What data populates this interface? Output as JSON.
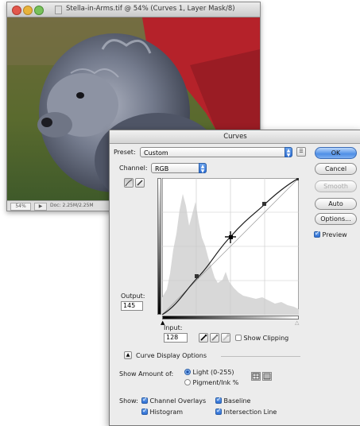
{
  "document": {
    "title": "Stella-in-Arms.tif @ 54% (Curves 1, Layer Mask/8)",
    "zoom": "54%",
    "doc_info": "Doc: 2.25M/2.25M"
  },
  "curves": {
    "title": "Curves",
    "preset_label": "Preset:",
    "preset_value": "Custom",
    "channel_label": "Channel:",
    "channel_value": "RGB",
    "output_label": "Output:",
    "output_value": "145",
    "input_label": "Input:",
    "input_value": "128",
    "show_clipping_label": "Show Clipping",
    "display_options_label": "Curve Display Options",
    "show_amount_label": "Show Amount of:",
    "light_label": "Light (0-255)",
    "pigment_label": "Pigment/Ink %",
    "show_label": "Show:",
    "channel_overlays_label": "Channel Overlays",
    "baseline_label": "Baseline",
    "histogram_label": "Histogram",
    "intersection_label": "Intersection Line",
    "buttons": {
      "ok": "OK",
      "cancel": "Cancel",
      "smooth": "Smooth",
      "auto": "Auto",
      "options": "Options..."
    },
    "preview_label": "Preview",
    "accent_color": "#3b7be0"
  }
}
